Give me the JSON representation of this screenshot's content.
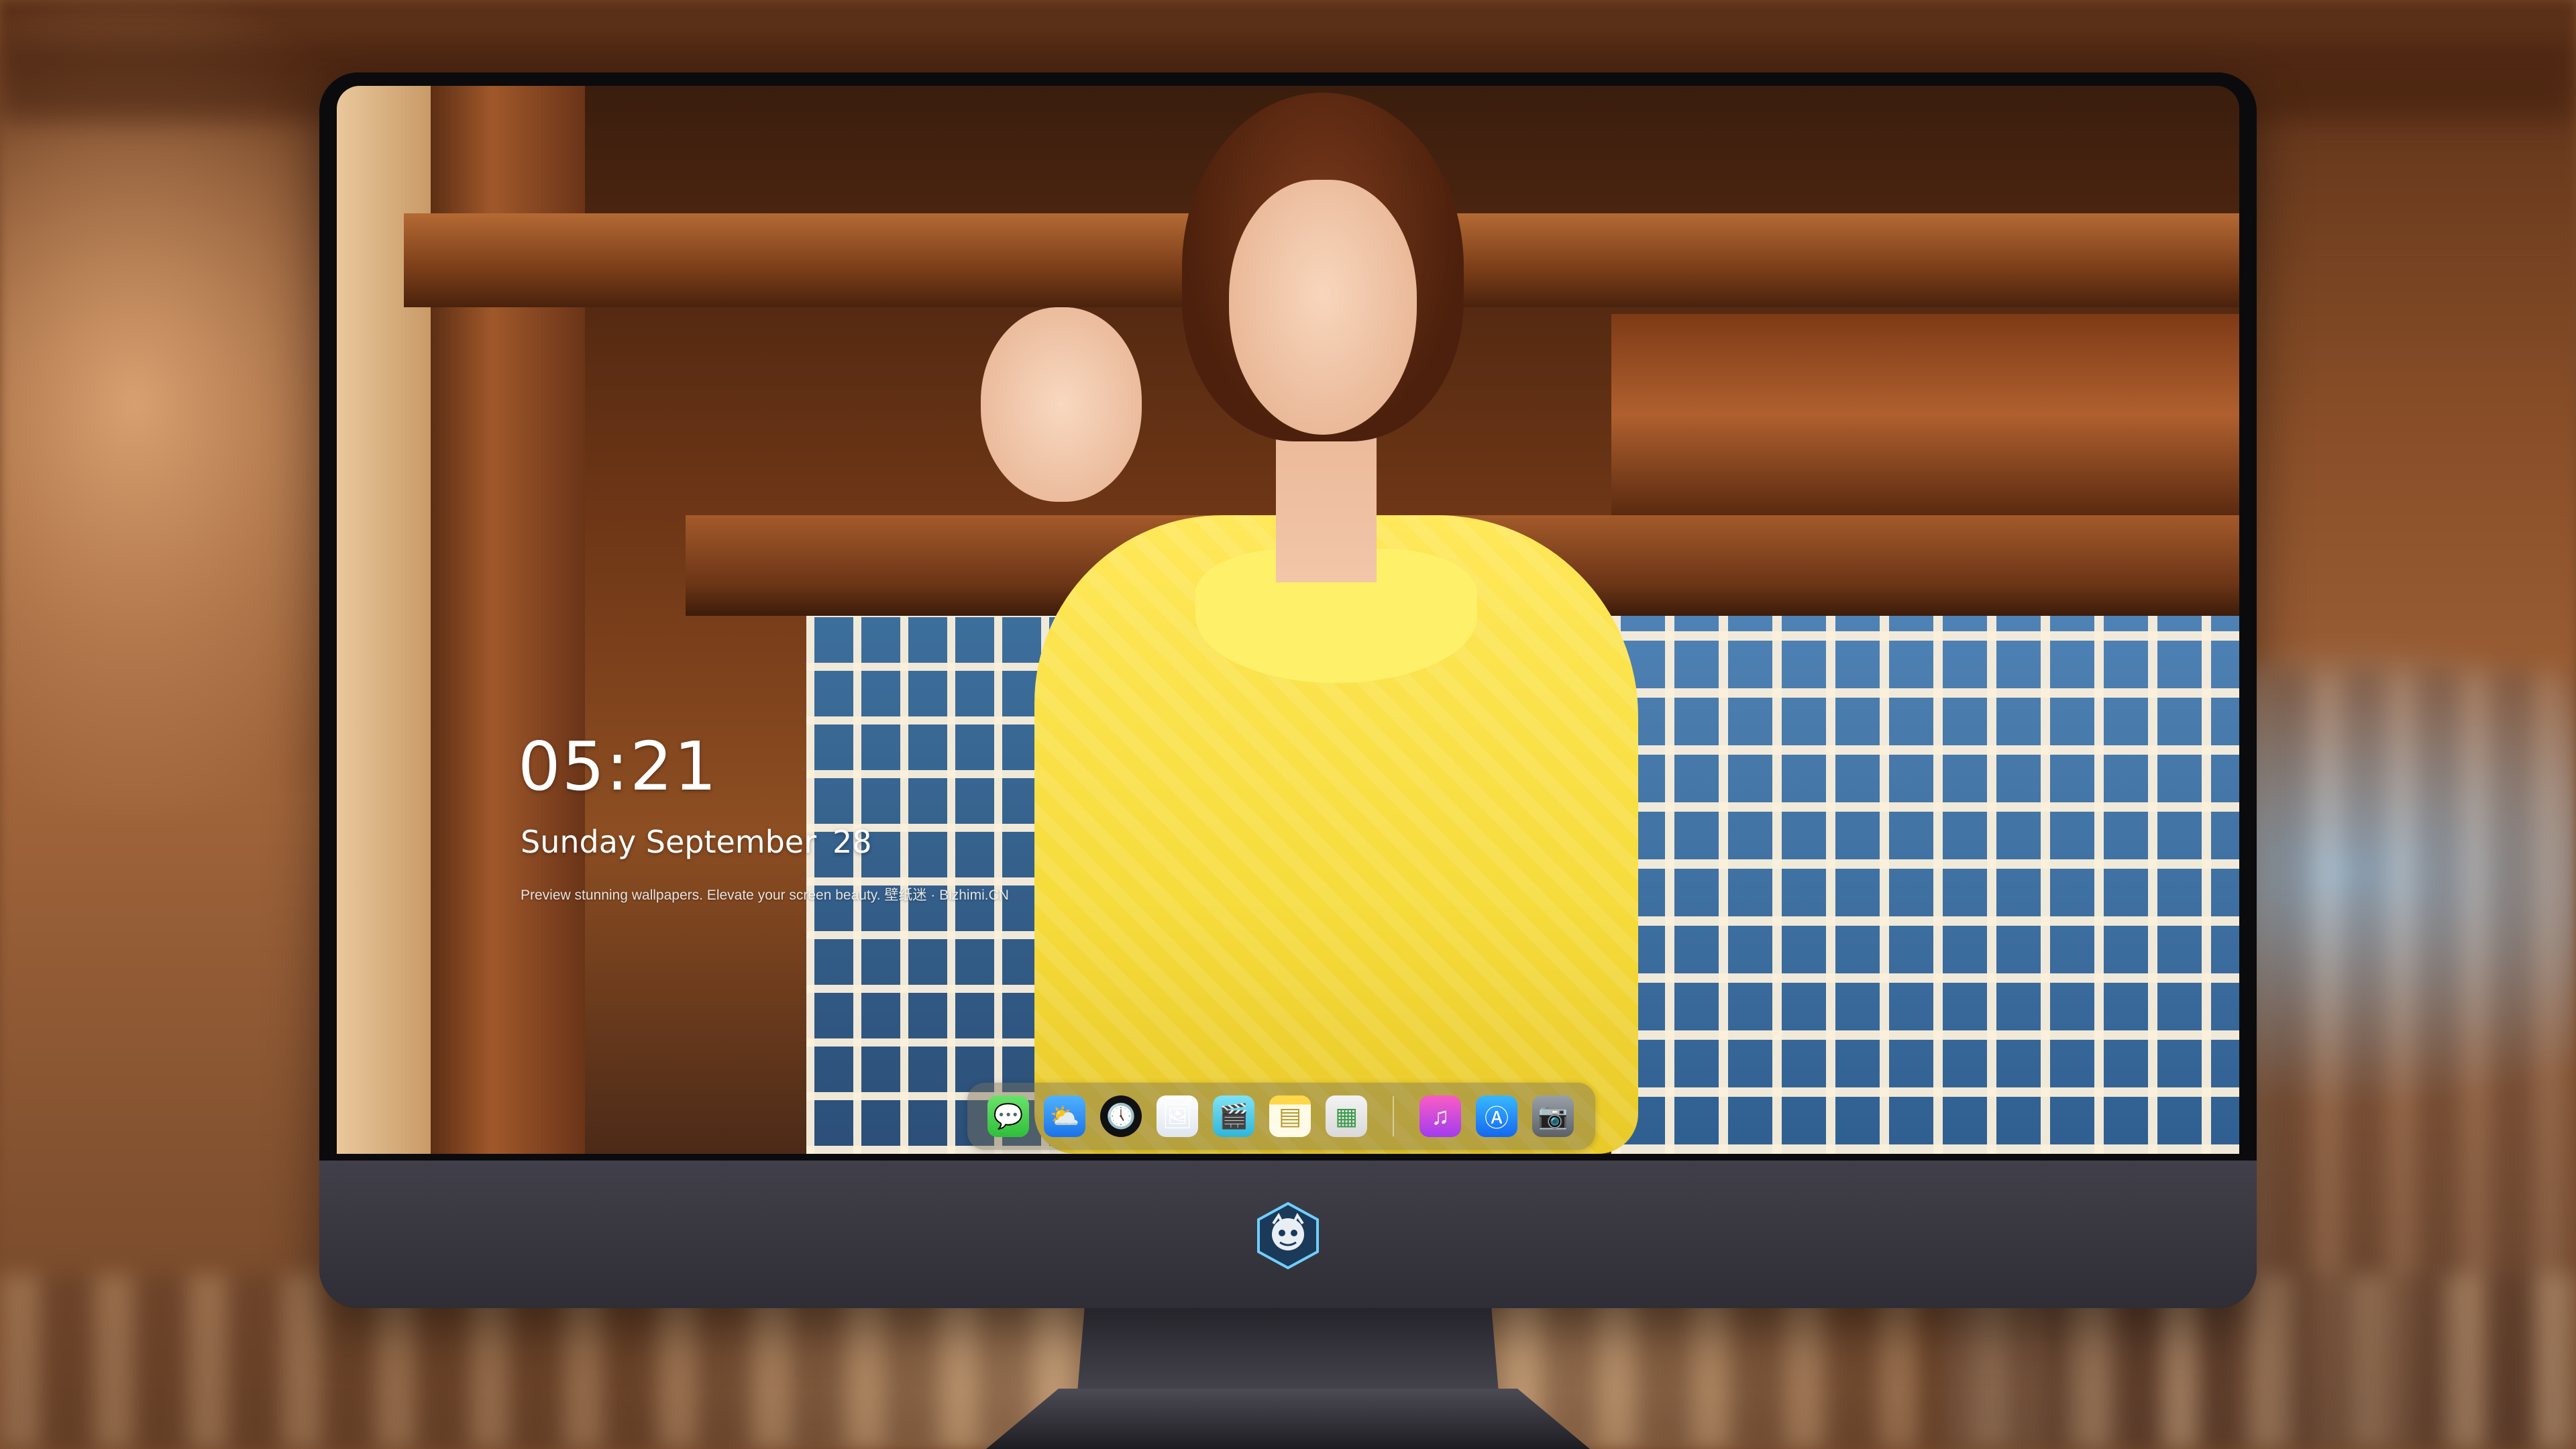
{
  "lockscreen": {
    "time": "05:21",
    "weekday_month": "Sunday September",
    "day": "28",
    "tagline": "Preview stunning wallpapers. Elevate your screen beauty. 壁纸迷 · Bizhimi.CN"
  },
  "dock": {
    "apps": [
      {
        "name": "Messages",
        "icon": "messages-icon",
        "glyph": "💬"
      },
      {
        "name": "Weather",
        "icon": "weather-icon",
        "glyph": "⛅"
      },
      {
        "name": "Clock",
        "icon": "clock-icon",
        "glyph": "🕔"
      },
      {
        "name": "Preview",
        "icon": "preview-icon",
        "glyph": "🖼"
      },
      {
        "name": "Clips",
        "icon": "clapperboard-icon",
        "glyph": "🎬"
      },
      {
        "name": "Notes",
        "icon": "notes-icon",
        "glyph": "▤"
      },
      {
        "name": "Photos",
        "icon": "photos-icon",
        "glyph": "▦"
      },
      {
        "name": "Music",
        "icon": "music-icon",
        "glyph": "♫"
      },
      {
        "name": "App Store",
        "icon": "appstore-icon",
        "glyph": "Ⓐ"
      },
      {
        "name": "Camera",
        "icon": "camera-icon",
        "glyph": "📷"
      }
    ]
  },
  "colors": {
    "shirt": "#f6dc3c",
    "monitor_chin": "#36353d",
    "dock_bg": "rgba(120,110,90,.45)"
  }
}
